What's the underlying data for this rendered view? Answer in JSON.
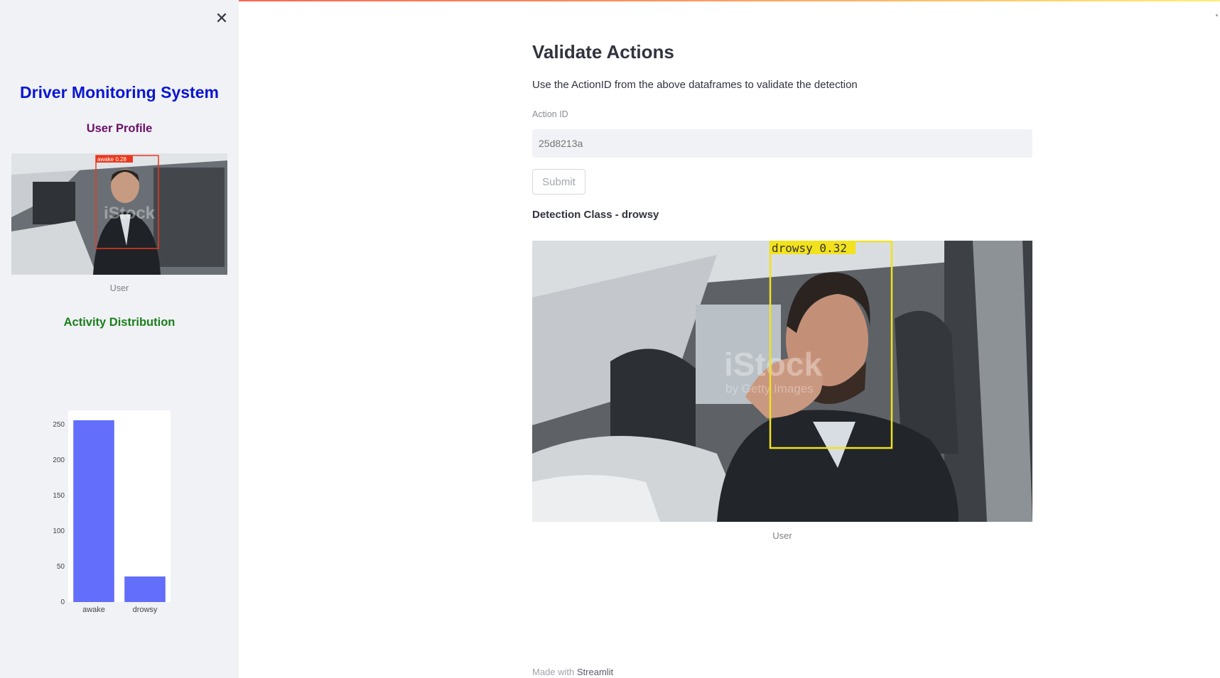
{
  "sidebar": {
    "close_icon": "close-icon",
    "title": "Driver Monitoring System",
    "user_profile_heading": "User Profile",
    "profile_image": {
      "detection_label": "awake 0.28",
      "watermark": "iStock",
      "box_color": "#e8391f"
    },
    "profile_caption": "User",
    "activity_heading": "Activity Distribution"
  },
  "chart_data": {
    "type": "bar",
    "categories": [
      "awake",
      "drowsy"
    ],
    "values": [
      256,
      36
    ],
    "ylim": [
      0,
      270
    ],
    "yticks": [
      0,
      50,
      100,
      150,
      200,
      250
    ],
    "bar_color": "#636efa"
  },
  "main": {
    "title": "Validate Actions",
    "description": "Use the ActionID from the above dataframes to validate the detection",
    "action_id": {
      "label": "Action ID",
      "placeholder": "25d8213a",
      "value": ""
    },
    "submit_label": "Submit",
    "detection_class": "Detection Class - drowsy",
    "detection_image": {
      "detection_label": "drowsy 0.32",
      "watermark": "iStock",
      "watermark_sub": "by Getty Images",
      "box_color": "#f2e21d"
    },
    "image_caption": "User"
  },
  "footer": {
    "made_with": "Made with",
    "brand": "Streamlit"
  },
  "colors": {
    "accent": "#ff4b4b",
    "sidebar_bg": "#f0f2f6",
    "title_blue": "#0b16cf",
    "profile_purple": "#6b0f66",
    "activity_green": "#1a7f1a"
  }
}
